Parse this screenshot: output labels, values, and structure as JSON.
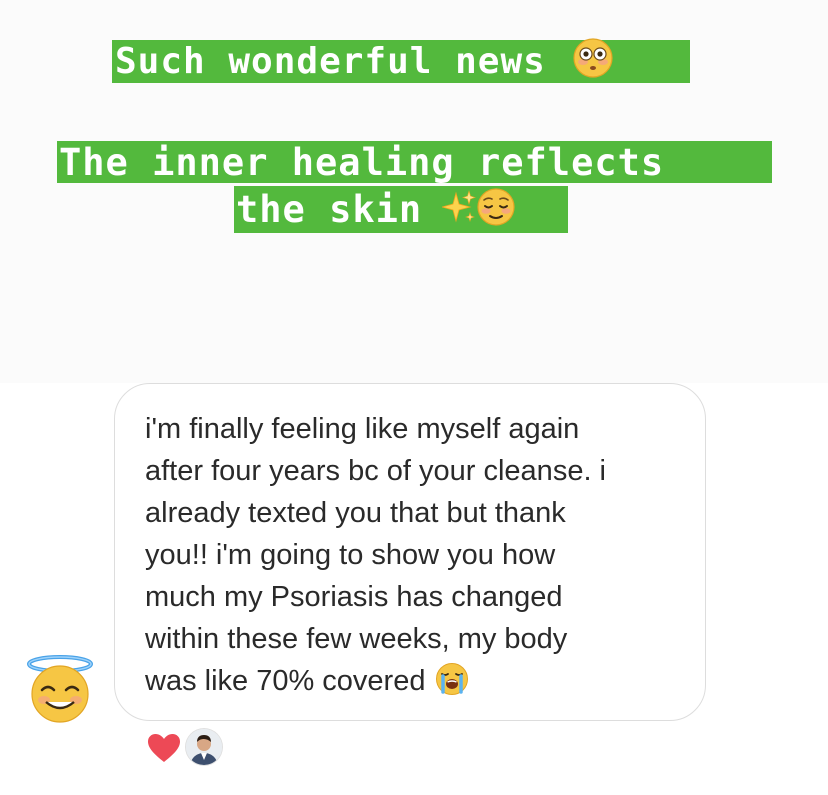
{
  "story": {
    "line1": "Such wonderful news",
    "line1_emoji": "flushed-face-icon",
    "line2": "The inner healing reflects",
    "line3": "the skin",
    "line3_emojis": [
      "sparkles-icon",
      "relieved-face-icon"
    ],
    "highlight_color": "#53b93d",
    "text_color": "#ffffff"
  },
  "message": {
    "lines": [
      "i'm finally feeling like myself again",
      "after four years bc of your cleanse. i",
      "already texted you that but thank",
      "you!! i'm going to show you how",
      "much my Psoriasis has changed",
      "within these few weeks, my body",
      "was like 70% covered"
    ],
    "trailing_emoji": "loudly-crying-face-icon",
    "sender_avatar": "smiling-face-with-halo-icon",
    "reaction": "heart-icon",
    "reactor": "profile-avatar"
  },
  "colors": {
    "bubble_border": "#dddddd",
    "heart": "#ed4956",
    "text": "#2a2a2a"
  }
}
